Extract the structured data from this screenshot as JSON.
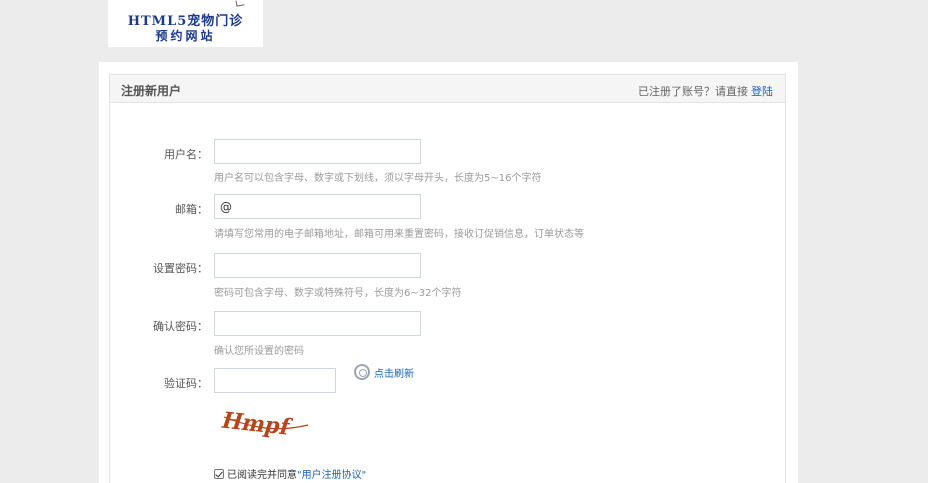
{
  "logo": {
    "line1": "HTML5宠物门诊",
    "line2": "预约网站"
  },
  "panel": {
    "title": "注册新用户",
    "login_hint": "已注册了账号？请直接",
    "login_link": "登陆"
  },
  "form": {
    "username": {
      "label": "用户名：",
      "value": "",
      "hint": "用户名可以包含字母、数字或下划线，须以字母开头，长度为5~16个字符"
    },
    "email": {
      "label": "邮箱：",
      "value": "@",
      "hint": "请填写您常用的电子邮箱地址，邮箱可用来重置密码，接收订促销信息，订单状态等"
    },
    "password": {
      "label": "设置密码：",
      "value": "",
      "hint": "密码可包含字母、数字或特殊符号，长度为6~32个字符"
    },
    "confirm_password": {
      "label": "确认密码：",
      "value": "",
      "hint": "确认您所设置的密码"
    },
    "captcha": {
      "label": "验证码：",
      "value": "",
      "refresh_text": "点击刷新",
      "image_text": "Hmpf"
    },
    "agreement": {
      "prefix": "已阅读完并同意",
      "link": "\"用户注册协议\""
    }
  },
  "colors": {
    "link": "#1a63b2",
    "logo_text": "#1d3a8a",
    "captcha": "#b5451b"
  }
}
